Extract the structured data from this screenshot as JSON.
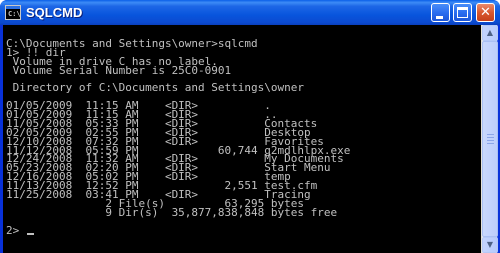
{
  "window": {
    "title": "SQLCMD",
    "icon_label": "C:\\",
    "buttons": {
      "minimize": "minimize-icon",
      "maximize": "maximize-icon",
      "close": "✕"
    }
  },
  "console": {
    "lines": [
      "",
      "C:\\Documents and Settings\\owner>sqlcmd",
      "1> !! dir",
      " Volume in drive C has no label.",
      " Volume Serial Number is 25C0-0901",
      "",
      " Directory of C:\\Documents and Settings\\owner",
      "",
      "01/05/2009  11:15 AM    <DIR>          .",
      "01/05/2009  11:15 AM    <DIR>          ..",
      "11/05/2008  05:33 PM    <DIR>          Contacts",
      "02/05/2009  02:55 PM    <DIR>          Desktop",
      "12/10/2008  07:32 PM    <DIR>          Favorites",
      "11/12/2008  05:59 PM            60,744 g2mdlhlpx.exe",
      "12/24/2008  11:32 AM    <DIR>          My Documents",
      "05/23/2008  02:20 PM    <DIR>          Start Menu",
      "12/16/2008  05:02 PM    <DIR>          temp",
      "11/13/2008  12:52 PM             2,551 test.cfm",
      "11/25/2008  03:41 PM    <DIR>          Tracing",
      "               2 File(s)         63,295 bytes",
      "               9 Dir(s)  35,877,838,848 bytes free",
      "",
      "2> "
    ]
  }
}
